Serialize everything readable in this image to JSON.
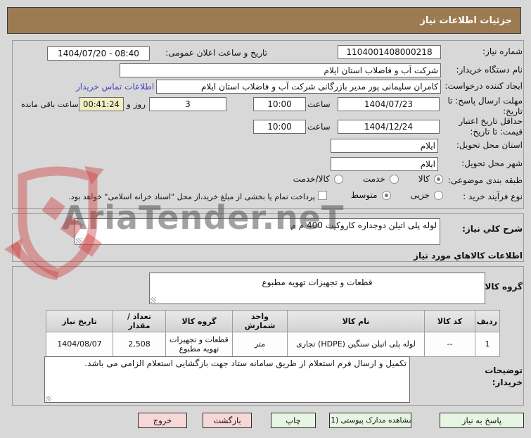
{
  "title_bar": {
    "title": "جزئیات اطلاعات نیاز"
  },
  "watermark": {
    "text": "AriaTender.neT"
  },
  "form": {
    "need_number": {
      "label": "شماره نیاز:",
      "value": "1104001408000218"
    },
    "public_announce": {
      "label": "تاریخ و ساعت اعلان عمومی:",
      "value": "1404/07/20 - 08:40"
    },
    "buyer_org": {
      "label": "نام دستگاه خریدار:",
      "value": "شرکت آب و فاضلاب استان ایلام"
    },
    "request_creator": {
      "label": "ایجاد کننده درخواست:",
      "value": "کامران سلیمانی پور مدیر بازرگانی شرکت آب و فاضلاب استان ایلام",
      "contact_link": "اطلاعات تماس خریدار"
    },
    "response_deadline": {
      "label": "مهلت ارسال پاسخ: تا تاریخ:",
      "date": "1404/07/23",
      "time_label": "ساعت",
      "time": "10:00",
      "days_left": "3",
      "days_word": "روز و",
      "countdown": "00:41:24",
      "countdown_label": "ساعت باقی مانده"
    },
    "price_validity": {
      "label": "حداقل تاریخ اعتبار قیمت: تا تاریخ:",
      "date": "1404/12/24",
      "time_label": "ساعت",
      "time": "10:00"
    },
    "delivery_province": {
      "label": "استان محل تحویل:",
      "value": "ایلام"
    },
    "delivery_city": {
      "label": "شهر محل تحویل:",
      "value": "ایلام"
    },
    "subject_class": {
      "label": "طبقه بندی موضوعی:",
      "options": [
        "کالا",
        "خدمت",
        "کالا/خدمت"
      ],
      "selected": "کالا"
    },
    "purchase_process": {
      "label": "نوع فرآیند خرید :",
      "options": [
        "جزیی",
        "متوسط"
      ],
      "selected": "متوسط",
      "treasury_note": "پرداخت تمام یا بخشی از مبلغ خرید،از محل \"اسناد خزانه اسلامی\" خواهد بود."
    }
  },
  "need_desc": {
    "label": "شرح کلي نیاز:",
    "value": "لوله پلی اتیلن دوجداره کاروکیت 400 م م"
  },
  "goods_section": {
    "heading": "اطلاعات کالاهاي مورد نیاز",
    "group_label": "گروه کالا:",
    "group_value": "قطعات و تجهیزات تهویه مطبوع"
  },
  "items_table": {
    "headers": [
      "ردیف",
      "کد کالا",
      "نام کالا",
      "واحد شمارش",
      "گروه کالا",
      "تعداد / مقدار",
      "تاریخ نیاز"
    ],
    "row": [
      "1",
      "--",
      "لوله پلی اتیلن سنگین (HDPE) تجاری",
      "متر",
      "قطعات و تجهیزات تهویه مطبوع",
      "2,508",
      "1404/08/07"
    ]
  },
  "buyer_notes": {
    "label": "توضیحات خریدار:",
    "value": "تکمیل و ارسال فرم استعلام از طریق سامانه ستاد جهت بازگشایی استعلام الزامی می باشد."
  },
  "buttons": {
    "respond": "پاسخ به نیاز",
    "view_docs": "مشاهده مدارک پیوستی (1)",
    "print": "چاپ",
    "back": "بازگشت",
    "exit": "خروج"
  },
  "colors": {
    "titlebar_bg": "#9c7b52",
    "countdown_bg": "#f3efc4",
    "button_green": "#e7f6e3",
    "button_pink": "#f8d7d7",
    "link": "#4343c8"
  }
}
